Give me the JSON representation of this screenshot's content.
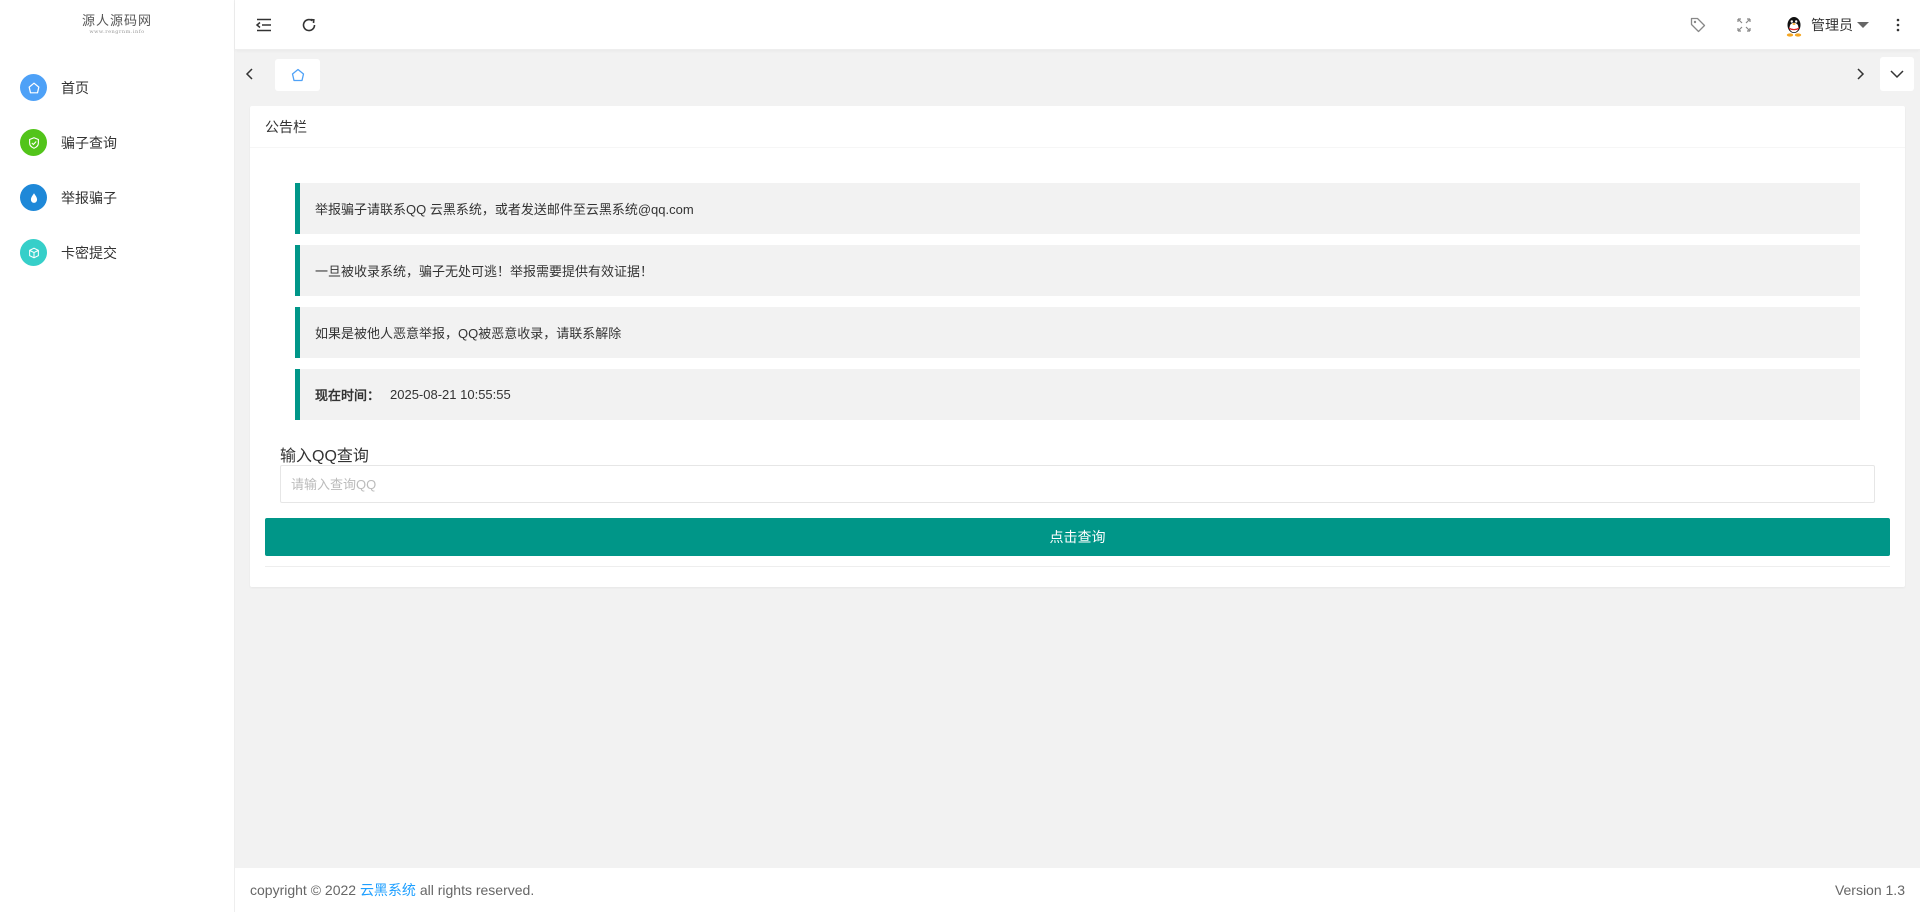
{
  "logo": {
    "title": "源人源码网",
    "subtitle": "www.rengrnm.info"
  },
  "sidebar": {
    "items": [
      {
        "label": "首页",
        "icon": "home-icon",
        "color": "#4ea1f7"
      },
      {
        "label": "骗子查询",
        "icon": "shield-check-icon",
        "color": "#52c41a"
      },
      {
        "label": "举报骗子",
        "icon": "drop-icon",
        "color": "#1e88d8"
      },
      {
        "label": "卡密提交",
        "icon": "cube-icon",
        "color": "#36cfc9"
      }
    ]
  },
  "header": {
    "user_name": "管理员"
  },
  "card": {
    "title": "公告栏",
    "notices": [
      "举报骗子请联系QQ 云黑系统，或者发送邮件至云黑系统@qq.com",
      "一旦被收录系统，骗子无处可逃！举报需要提供有效证据！",
      "如果是被他人恶意举报，QQ被恶意收录，请联系解除"
    ],
    "time_label": "现在时间：",
    "time_value": "2025-08-21 10:55:55",
    "form_label": "输入QQ查询",
    "input_placeholder": "请输入查询QQ",
    "input_value": "",
    "button_label": "点击查询"
  },
  "footer": {
    "copyright_prefix": "copyright © 2022",
    "brand": "云黑系统",
    "copyright_suffix": "all rights reserved.",
    "version": "Version 1.3"
  },
  "colors": {
    "accent": "#009688",
    "link": "#1e9fff"
  }
}
